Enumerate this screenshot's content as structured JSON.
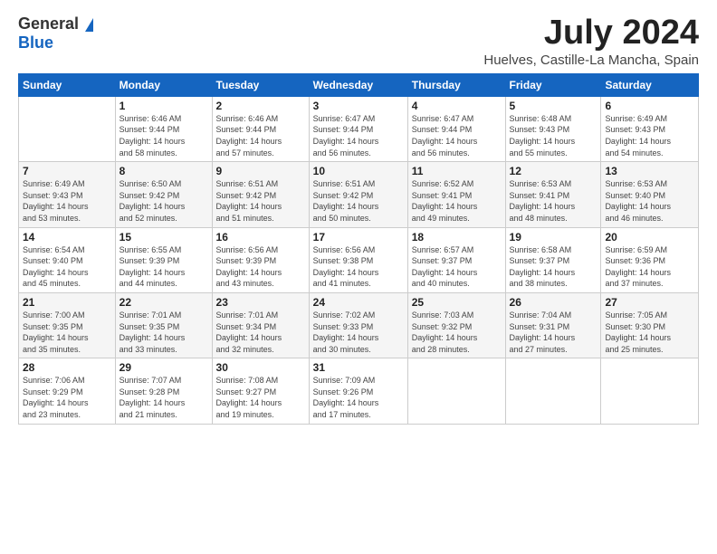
{
  "header": {
    "logo_general": "General",
    "logo_blue": "Blue",
    "month": "July 2024",
    "location": "Huelves, Castille-La Mancha, Spain"
  },
  "days_of_week": [
    "Sunday",
    "Monday",
    "Tuesday",
    "Wednesday",
    "Thursday",
    "Friday",
    "Saturday"
  ],
  "weeks": [
    [
      {
        "day": "",
        "info": ""
      },
      {
        "day": "1",
        "info": "Sunrise: 6:46 AM\nSunset: 9:44 PM\nDaylight: 14 hours\nand 58 minutes."
      },
      {
        "day": "2",
        "info": "Sunrise: 6:46 AM\nSunset: 9:44 PM\nDaylight: 14 hours\nand 57 minutes."
      },
      {
        "day": "3",
        "info": "Sunrise: 6:47 AM\nSunset: 9:44 PM\nDaylight: 14 hours\nand 56 minutes."
      },
      {
        "day": "4",
        "info": "Sunrise: 6:47 AM\nSunset: 9:44 PM\nDaylight: 14 hours\nand 56 minutes."
      },
      {
        "day": "5",
        "info": "Sunrise: 6:48 AM\nSunset: 9:43 PM\nDaylight: 14 hours\nand 55 minutes."
      },
      {
        "day": "6",
        "info": "Sunrise: 6:49 AM\nSunset: 9:43 PM\nDaylight: 14 hours\nand 54 minutes."
      }
    ],
    [
      {
        "day": "7",
        "info": "Sunrise: 6:49 AM\nSunset: 9:43 PM\nDaylight: 14 hours\nand 53 minutes."
      },
      {
        "day": "8",
        "info": "Sunrise: 6:50 AM\nSunset: 9:42 PM\nDaylight: 14 hours\nand 52 minutes."
      },
      {
        "day": "9",
        "info": "Sunrise: 6:51 AM\nSunset: 9:42 PM\nDaylight: 14 hours\nand 51 minutes."
      },
      {
        "day": "10",
        "info": "Sunrise: 6:51 AM\nSunset: 9:42 PM\nDaylight: 14 hours\nand 50 minutes."
      },
      {
        "day": "11",
        "info": "Sunrise: 6:52 AM\nSunset: 9:41 PM\nDaylight: 14 hours\nand 49 minutes."
      },
      {
        "day": "12",
        "info": "Sunrise: 6:53 AM\nSunset: 9:41 PM\nDaylight: 14 hours\nand 48 minutes."
      },
      {
        "day": "13",
        "info": "Sunrise: 6:53 AM\nSunset: 9:40 PM\nDaylight: 14 hours\nand 46 minutes."
      }
    ],
    [
      {
        "day": "14",
        "info": "Sunrise: 6:54 AM\nSunset: 9:40 PM\nDaylight: 14 hours\nand 45 minutes."
      },
      {
        "day": "15",
        "info": "Sunrise: 6:55 AM\nSunset: 9:39 PM\nDaylight: 14 hours\nand 44 minutes."
      },
      {
        "day": "16",
        "info": "Sunrise: 6:56 AM\nSunset: 9:39 PM\nDaylight: 14 hours\nand 43 minutes."
      },
      {
        "day": "17",
        "info": "Sunrise: 6:56 AM\nSunset: 9:38 PM\nDaylight: 14 hours\nand 41 minutes."
      },
      {
        "day": "18",
        "info": "Sunrise: 6:57 AM\nSunset: 9:37 PM\nDaylight: 14 hours\nand 40 minutes."
      },
      {
        "day": "19",
        "info": "Sunrise: 6:58 AM\nSunset: 9:37 PM\nDaylight: 14 hours\nand 38 minutes."
      },
      {
        "day": "20",
        "info": "Sunrise: 6:59 AM\nSunset: 9:36 PM\nDaylight: 14 hours\nand 37 minutes."
      }
    ],
    [
      {
        "day": "21",
        "info": "Sunrise: 7:00 AM\nSunset: 9:35 PM\nDaylight: 14 hours\nand 35 minutes."
      },
      {
        "day": "22",
        "info": "Sunrise: 7:01 AM\nSunset: 9:35 PM\nDaylight: 14 hours\nand 33 minutes."
      },
      {
        "day": "23",
        "info": "Sunrise: 7:01 AM\nSunset: 9:34 PM\nDaylight: 14 hours\nand 32 minutes."
      },
      {
        "day": "24",
        "info": "Sunrise: 7:02 AM\nSunset: 9:33 PM\nDaylight: 14 hours\nand 30 minutes."
      },
      {
        "day": "25",
        "info": "Sunrise: 7:03 AM\nSunset: 9:32 PM\nDaylight: 14 hours\nand 28 minutes."
      },
      {
        "day": "26",
        "info": "Sunrise: 7:04 AM\nSunset: 9:31 PM\nDaylight: 14 hours\nand 27 minutes."
      },
      {
        "day": "27",
        "info": "Sunrise: 7:05 AM\nSunset: 9:30 PM\nDaylight: 14 hours\nand 25 minutes."
      }
    ],
    [
      {
        "day": "28",
        "info": "Sunrise: 7:06 AM\nSunset: 9:29 PM\nDaylight: 14 hours\nand 23 minutes."
      },
      {
        "day": "29",
        "info": "Sunrise: 7:07 AM\nSunset: 9:28 PM\nDaylight: 14 hours\nand 21 minutes."
      },
      {
        "day": "30",
        "info": "Sunrise: 7:08 AM\nSunset: 9:27 PM\nDaylight: 14 hours\nand 19 minutes."
      },
      {
        "day": "31",
        "info": "Sunrise: 7:09 AM\nSunset: 9:26 PM\nDaylight: 14 hours\nand 17 minutes."
      },
      {
        "day": "",
        "info": ""
      },
      {
        "day": "",
        "info": ""
      },
      {
        "day": "",
        "info": ""
      }
    ]
  ]
}
